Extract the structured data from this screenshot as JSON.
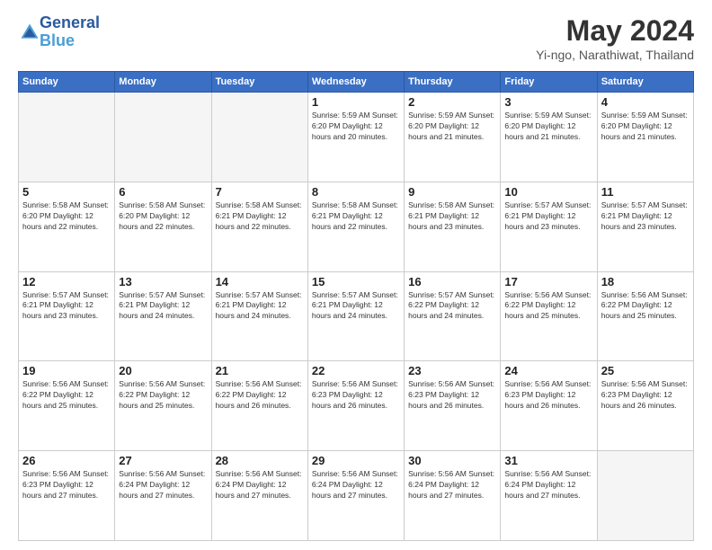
{
  "header": {
    "logo_line1": "General",
    "logo_line2": "Blue",
    "month": "May 2024",
    "location": "Yi-ngo, Narathiwat, Thailand"
  },
  "weekdays": [
    "Sunday",
    "Monday",
    "Tuesday",
    "Wednesday",
    "Thursday",
    "Friday",
    "Saturday"
  ],
  "weeks": [
    [
      {
        "day": "",
        "info": ""
      },
      {
        "day": "",
        "info": ""
      },
      {
        "day": "",
        "info": ""
      },
      {
        "day": "1",
        "info": "Sunrise: 5:59 AM\nSunset: 6:20 PM\nDaylight: 12 hours\nand 20 minutes."
      },
      {
        "day": "2",
        "info": "Sunrise: 5:59 AM\nSunset: 6:20 PM\nDaylight: 12 hours\nand 21 minutes."
      },
      {
        "day": "3",
        "info": "Sunrise: 5:59 AM\nSunset: 6:20 PM\nDaylight: 12 hours\nand 21 minutes."
      },
      {
        "day": "4",
        "info": "Sunrise: 5:59 AM\nSunset: 6:20 PM\nDaylight: 12 hours\nand 21 minutes."
      }
    ],
    [
      {
        "day": "5",
        "info": "Sunrise: 5:58 AM\nSunset: 6:20 PM\nDaylight: 12 hours\nand 22 minutes."
      },
      {
        "day": "6",
        "info": "Sunrise: 5:58 AM\nSunset: 6:20 PM\nDaylight: 12 hours\nand 22 minutes."
      },
      {
        "day": "7",
        "info": "Sunrise: 5:58 AM\nSunset: 6:21 PM\nDaylight: 12 hours\nand 22 minutes."
      },
      {
        "day": "8",
        "info": "Sunrise: 5:58 AM\nSunset: 6:21 PM\nDaylight: 12 hours\nand 22 minutes."
      },
      {
        "day": "9",
        "info": "Sunrise: 5:58 AM\nSunset: 6:21 PM\nDaylight: 12 hours\nand 23 minutes."
      },
      {
        "day": "10",
        "info": "Sunrise: 5:57 AM\nSunset: 6:21 PM\nDaylight: 12 hours\nand 23 minutes."
      },
      {
        "day": "11",
        "info": "Sunrise: 5:57 AM\nSunset: 6:21 PM\nDaylight: 12 hours\nand 23 minutes."
      }
    ],
    [
      {
        "day": "12",
        "info": "Sunrise: 5:57 AM\nSunset: 6:21 PM\nDaylight: 12 hours\nand 23 minutes."
      },
      {
        "day": "13",
        "info": "Sunrise: 5:57 AM\nSunset: 6:21 PM\nDaylight: 12 hours\nand 24 minutes."
      },
      {
        "day": "14",
        "info": "Sunrise: 5:57 AM\nSunset: 6:21 PM\nDaylight: 12 hours\nand 24 minutes."
      },
      {
        "day": "15",
        "info": "Sunrise: 5:57 AM\nSunset: 6:21 PM\nDaylight: 12 hours\nand 24 minutes."
      },
      {
        "day": "16",
        "info": "Sunrise: 5:57 AM\nSunset: 6:22 PM\nDaylight: 12 hours\nand 24 minutes."
      },
      {
        "day": "17",
        "info": "Sunrise: 5:56 AM\nSunset: 6:22 PM\nDaylight: 12 hours\nand 25 minutes."
      },
      {
        "day": "18",
        "info": "Sunrise: 5:56 AM\nSunset: 6:22 PM\nDaylight: 12 hours\nand 25 minutes."
      }
    ],
    [
      {
        "day": "19",
        "info": "Sunrise: 5:56 AM\nSunset: 6:22 PM\nDaylight: 12 hours\nand 25 minutes."
      },
      {
        "day": "20",
        "info": "Sunrise: 5:56 AM\nSunset: 6:22 PM\nDaylight: 12 hours\nand 25 minutes."
      },
      {
        "day": "21",
        "info": "Sunrise: 5:56 AM\nSunset: 6:22 PM\nDaylight: 12 hours\nand 26 minutes."
      },
      {
        "day": "22",
        "info": "Sunrise: 5:56 AM\nSunset: 6:23 PM\nDaylight: 12 hours\nand 26 minutes."
      },
      {
        "day": "23",
        "info": "Sunrise: 5:56 AM\nSunset: 6:23 PM\nDaylight: 12 hours\nand 26 minutes."
      },
      {
        "day": "24",
        "info": "Sunrise: 5:56 AM\nSunset: 6:23 PM\nDaylight: 12 hours\nand 26 minutes."
      },
      {
        "day": "25",
        "info": "Sunrise: 5:56 AM\nSunset: 6:23 PM\nDaylight: 12 hours\nand 26 minutes."
      }
    ],
    [
      {
        "day": "26",
        "info": "Sunrise: 5:56 AM\nSunset: 6:23 PM\nDaylight: 12 hours\nand 27 minutes."
      },
      {
        "day": "27",
        "info": "Sunrise: 5:56 AM\nSunset: 6:24 PM\nDaylight: 12 hours\nand 27 minutes."
      },
      {
        "day": "28",
        "info": "Sunrise: 5:56 AM\nSunset: 6:24 PM\nDaylight: 12 hours\nand 27 minutes."
      },
      {
        "day": "29",
        "info": "Sunrise: 5:56 AM\nSunset: 6:24 PM\nDaylight: 12 hours\nand 27 minutes."
      },
      {
        "day": "30",
        "info": "Sunrise: 5:56 AM\nSunset: 6:24 PM\nDaylight: 12 hours\nand 27 minutes."
      },
      {
        "day": "31",
        "info": "Sunrise: 5:56 AM\nSunset: 6:24 PM\nDaylight: 12 hours\nand 27 minutes."
      },
      {
        "day": "",
        "info": ""
      }
    ]
  ]
}
